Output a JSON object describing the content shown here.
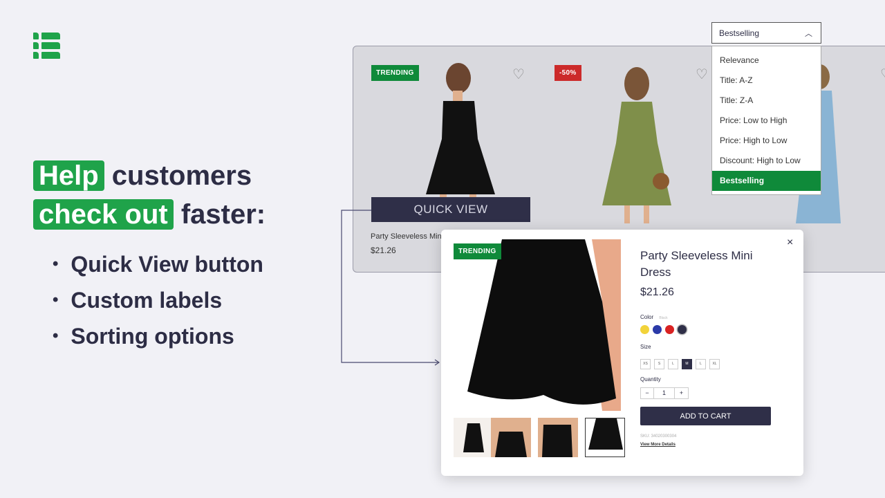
{
  "logo": {
    "icon": "list-logo-icon",
    "color": "#1fa34a"
  },
  "headline": {
    "hl1": "Help",
    "t1": " customers",
    "hl2": "check out",
    "t2": " faster:"
  },
  "bullets": [
    "Quick View button",
    "Custom labels",
    "Sorting options"
  ],
  "grid": {
    "products": [
      {
        "badge": "TRENDING",
        "badge_color": "#0f8a3a",
        "name": "Party Sleeveless Mini Dress",
        "price": "$21.26"
      },
      {
        "badge": "-50%",
        "badge_color": "#cc2a2a"
      }
    ],
    "quick_view": "QUICK VIEW"
  },
  "sort": {
    "selected": "Bestselling",
    "options": [
      "Relevance",
      "Title: A-Z",
      "Title: Z-A",
      "Price: Low to High",
      "Price: High to Low",
      "Discount: High to Low",
      "Bestselling"
    ]
  },
  "modal": {
    "badge": "TRENDING",
    "title": "Party Sleeveless Mini Dress",
    "price": "$21.26",
    "color_label": "Color",
    "color_value": "Black",
    "colors": [
      "#f2d33a",
      "#2b3aa8",
      "#d92222",
      "#2f2f48"
    ],
    "size_label": "Size",
    "sizes": [
      "XS",
      "S",
      "L",
      "M",
      "L",
      "XL"
    ],
    "selected_size": "M",
    "quantity_label": "Quantity",
    "quantity": "1",
    "add_to_cart": "ADD TO CART",
    "sku": "SKU: 34020300304",
    "details": "View More Details"
  }
}
